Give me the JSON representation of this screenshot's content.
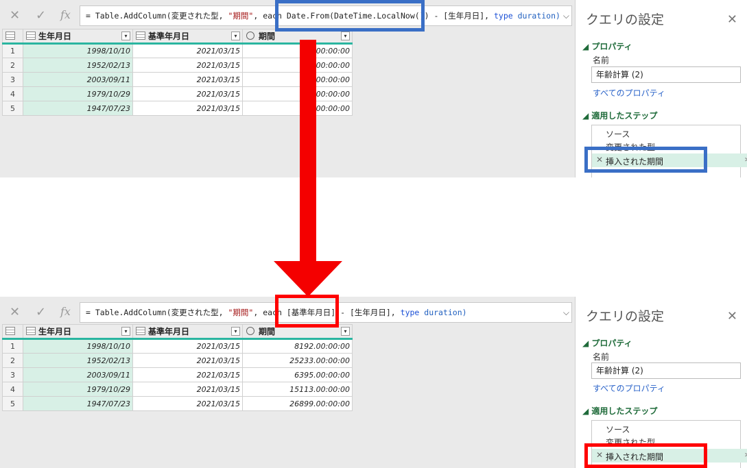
{
  "formula_before": {
    "prefix": "= Table.AddColumn(変更された型, ",
    "str": "\"期間\"",
    "mid": ", each ",
    "hl": "Date.From(DateTime.LocalNow())",
    "suffix": " - [生年月日], ",
    "kw": "type",
    "id": " duration)"
  },
  "formula_after": {
    "prefix": "= Table.AddColumn(変更された型, ",
    "str": "\"期間\"",
    "mid": ", each ",
    "hl": "[基準年月日]",
    "suffix": " - [生年月日], ",
    "kw": "type",
    "id": " duration)"
  },
  "formula_buttons": {
    "cancel": "✕",
    "commit": "✓",
    "fx": "fx"
  },
  "columns": [
    "生年月日",
    "基準年月日",
    "期間"
  ],
  "rows_before": [
    {
      "n": "1",
      "birth": "1998/10/10",
      "base": "2021/03/15",
      "dur": "00:00:00"
    },
    {
      "n": "2",
      "birth": "1952/02/13",
      "base": "2021/03/15",
      "dur": "00:00:00"
    },
    {
      "n": "3",
      "birth": "2003/09/11",
      "base": "2021/03/15",
      "dur": "00:00:00"
    },
    {
      "n": "4",
      "birth": "1979/10/29",
      "base": "2021/03/15",
      "dur": "00:00:00"
    },
    {
      "n": "5",
      "birth": "1947/07/23",
      "base": "2021/03/15",
      "dur": "00:00:00"
    }
  ],
  "rows_after": [
    {
      "n": "1",
      "birth": "1998/10/10",
      "base": "2021/03/15",
      "dur": "8192.00:00:00"
    },
    {
      "n": "2",
      "birth": "1952/02/13",
      "base": "2021/03/15",
      "dur": "25233.00:00:00"
    },
    {
      "n": "3",
      "birth": "2003/09/11",
      "base": "2021/03/15",
      "dur": "6395.00:00:00"
    },
    {
      "n": "4",
      "birth": "1979/10/29",
      "base": "2021/03/15",
      "dur": "15113.00:00:00"
    },
    {
      "n": "5",
      "birth": "1947/07/23",
      "base": "2021/03/15",
      "dur": "26899.00:00:00"
    }
  ],
  "query_settings": {
    "title": "クエリの設定",
    "close": "✕",
    "properties_header": "プロパティ",
    "name_label": "名前",
    "name_value": "年齢計算 (2)",
    "all_properties": "すべてのプロパティ",
    "steps_header": "適用したステップ",
    "steps": [
      "ソース",
      "変更された型",
      "挿入された期間"
    ]
  },
  "colors": {
    "blue_highlight": "#3a6fc6",
    "red_highlight": "#ff0000",
    "arrow": "#f40000",
    "selected_green": "#d8f0e6"
  }
}
